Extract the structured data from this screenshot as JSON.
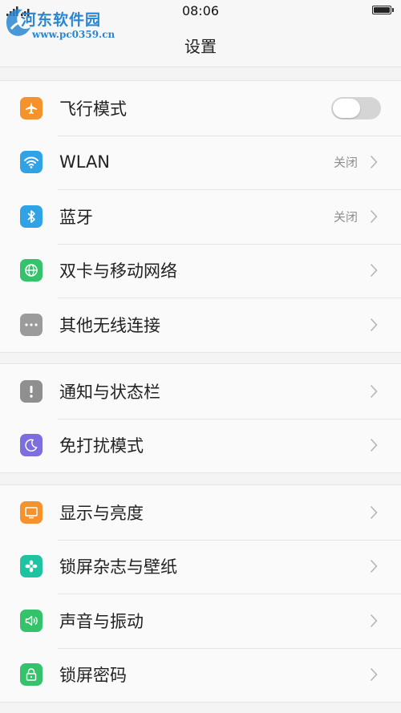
{
  "status_bar": {
    "time": "08:06"
  },
  "watermark": {
    "title": "河东软件园",
    "url": "www.pc0359.cn"
  },
  "header": {
    "title": "设置"
  },
  "groups": [
    {
      "items": [
        {
          "label": "飞行模式",
          "icon": "airplane-icon",
          "icon_color": "#f5922b",
          "control": "toggle",
          "toggle_on": false
        },
        {
          "label": "WLAN",
          "icon": "wifi-icon",
          "icon_color": "#2fa3e6",
          "value": "关闭"
        },
        {
          "label": "蓝牙",
          "icon": "bluetooth-icon",
          "icon_color": "#2fa3e6",
          "value": "关闭"
        },
        {
          "label": "双卡与移动网络",
          "icon": "globe-icon",
          "icon_color": "#34c36b"
        },
        {
          "label": "其他无线连接",
          "icon": "more-dots-icon",
          "icon_color": "#9b9b9b"
        }
      ]
    },
    {
      "items": [
        {
          "label": "通知与状态栏",
          "icon": "exclamation-icon",
          "icon_color": "#8f8f8f"
        },
        {
          "label": "免打扰模式",
          "icon": "moon-icon",
          "icon_color": "#7d6ee0"
        }
      ]
    },
    {
      "items": [
        {
          "label": "显示与亮度",
          "icon": "monitor-icon",
          "icon_color": "#f5922b"
        },
        {
          "label": "锁屏杂志与壁纸",
          "icon": "flower-icon",
          "icon_color": "#1ec3a2"
        },
        {
          "label": "声音与振动",
          "icon": "speaker-icon",
          "icon_color": "#34c36b"
        },
        {
          "label": "锁屏密码",
          "icon": "lock-icon",
          "icon_color": "#34c36b"
        }
      ]
    }
  ]
}
